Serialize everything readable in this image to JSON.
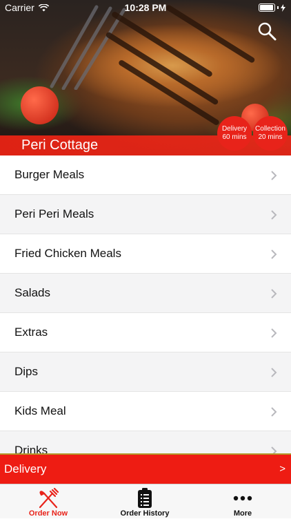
{
  "status_bar": {
    "carrier": "Carrier",
    "time": "10:28 PM"
  },
  "hero": {
    "restaurant_name": "Peri Cottage",
    "badges": {
      "delivery": {
        "line1": "Delivery",
        "line2": "60 mins"
      },
      "collection": {
        "line1": "Collection",
        "line2": "20 mins"
      }
    }
  },
  "menu": {
    "categories": [
      {
        "label": "Burger Meals"
      },
      {
        "label": "Peri Peri Meals"
      },
      {
        "label": "Fried Chicken Meals"
      },
      {
        "label": "Salads"
      },
      {
        "label": "Extras"
      },
      {
        "label": "Dips"
      },
      {
        "label": "Kids Meal"
      },
      {
        "label": "Drinks"
      }
    ]
  },
  "delivery_bar": {
    "label": "Delivery",
    "arrow": ">"
  },
  "tabbar": {
    "tabs": [
      {
        "label": "Order Now",
        "icon": "fork-knife-icon",
        "active": true
      },
      {
        "label": "Order History",
        "icon": "clipboard-list-icon",
        "active": false
      },
      {
        "label": "More",
        "icon": "ellipsis-icon",
        "active": false
      }
    ]
  },
  "colors": {
    "accent": "#e8231a",
    "bar_red": "#ee1c13",
    "row_alt": "#f4f4f5"
  }
}
